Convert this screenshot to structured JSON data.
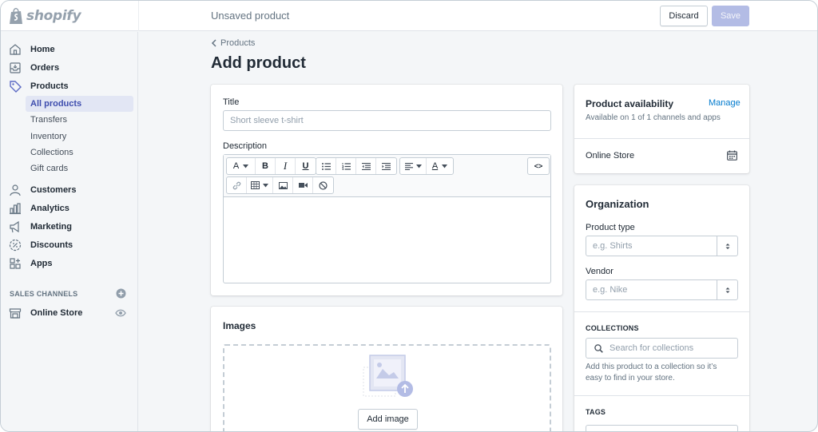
{
  "app": {
    "logo_text": "shopify",
    "page_status": "Unsaved product",
    "accent_color": "#5c6ac4",
    "save_disabled_color": "#b3bce5"
  },
  "topbar": {
    "discard_label": "Discard",
    "save_label": "Save"
  },
  "sidebar": {
    "items": [
      {
        "label": "Home",
        "icon": "home-icon"
      },
      {
        "label": "Orders",
        "icon": "orders-icon"
      },
      {
        "label": "Products",
        "icon": "tag-icon"
      },
      {
        "label": "Customers",
        "icon": "customers-icon"
      },
      {
        "label": "Analytics",
        "icon": "analytics-icon"
      },
      {
        "label": "Marketing",
        "icon": "marketing-icon"
      },
      {
        "label": "Discounts",
        "icon": "discounts-icon"
      },
      {
        "label": "Apps",
        "icon": "apps-icon"
      }
    ],
    "product_subitems": [
      {
        "label": "All products",
        "active": true
      },
      {
        "label": "Transfers",
        "active": false
      },
      {
        "label": "Inventory",
        "active": false
      },
      {
        "label": "Collections",
        "active": false
      },
      {
        "label": "Gift cards",
        "active": false
      }
    ],
    "sales_channels_heading": "SALES CHANNELS",
    "online_store_label": "Online Store"
  },
  "main": {
    "breadcrumb": "Products",
    "title": "Add product",
    "title_field": {
      "label": "Title",
      "placeholder": "Short sleeve t-shirt"
    },
    "description_label": "Description",
    "editor_toolbar": {
      "font_glyph": "A",
      "bold_glyph": "B",
      "italic_glyph": "I",
      "underline_glyph": "U",
      "text_color_glyph": "A",
      "html_glyph": "<>"
    },
    "images": {
      "title": "Images",
      "add_button": "Add image"
    }
  },
  "side": {
    "availability": {
      "title": "Product availability",
      "manage_link": "Manage",
      "subtitle": "Available on 1 of 1 channels and apps",
      "channel": "Online Store"
    },
    "organization": {
      "title": "Organization",
      "product_type_label": "Product type",
      "product_type_placeholder": "e.g. Shirts",
      "vendor_label": "Vendor",
      "vendor_placeholder": "e.g. Nike",
      "collections_heading": "COLLECTIONS",
      "collections_search_placeholder": "Search for collections",
      "collections_help_1": "Add this product to a collection so it’s",
      "collections_help_2": "easy to find in your store.",
      "tags_heading": "TAGS"
    }
  }
}
